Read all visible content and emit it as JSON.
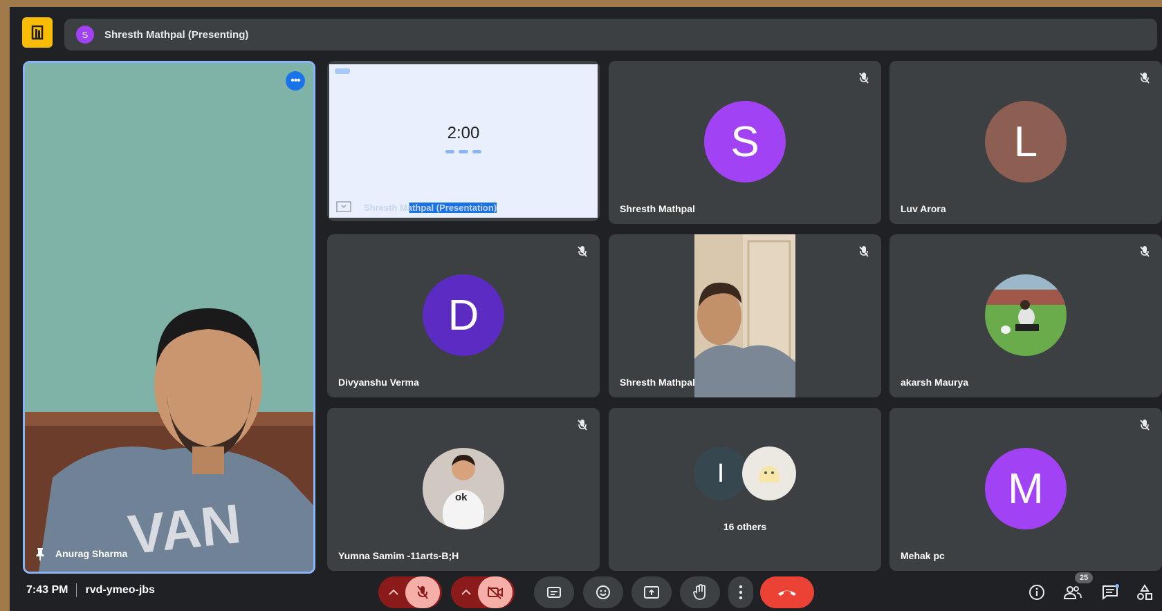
{
  "presenting_bar": {
    "avatar_initial": "S",
    "text": "Shresth Mathpal (Presenting)"
  },
  "main_tile": {
    "name": "Anurag Sharma",
    "more_label": "•••"
  },
  "presentation_tile": {
    "timer": "2:00",
    "caption": "Shresth Mathpal (Presentation)"
  },
  "tiles": [
    {
      "name": "Shresth Mathpal",
      "initial": "S",
      "color": "#a142f4"
    },
    {
      "name": "Luv Arora",
      "initial": "L",
      "color": "#8d5f52"
    },
    {
      "name": "Divyanshu Verma",
      "initial": "D",
      "color": "#5b2bc2"
    },
    {
      "name": "Shresth Mathpal"
    },
    {
      "name": "akarsh Maurya"
    },
    {
      "name": "Yumna Samim -11arts-B;H"
    },
    {
      "others_label": "16 others",
      "initial": "I"
    },
    {
      "name": "Mehak pc",
      "initial": "M",
      "color": "#a142f4"
    }
  ],
  "bottom": {
    "time": "7:43 PM",
    "meeting_code": "rvd-ymeo-jbs",
    "participants_badge": "25"
  },
  "colors": {
    "accent": "#8ab4f8",
    "end_call": "#ea4335",
    "mic_off_bg": "#f6aea9"
  }
}
